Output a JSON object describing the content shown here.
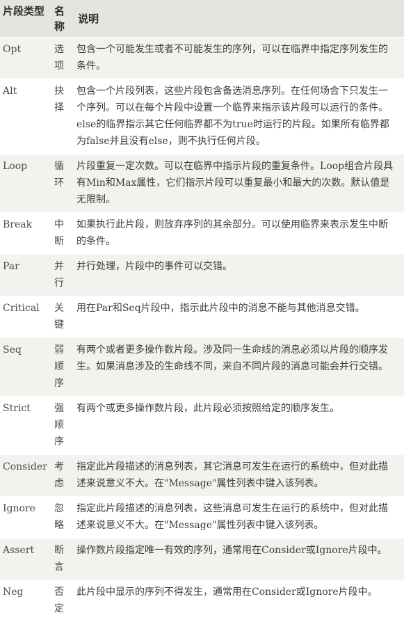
{
  "table": {
    "headers": {
      "type": "片段类型",
      "name": "名称",
      "desc": "说明"
    },
    "rows": [
      {
        "type": "Opt",
        "name": "选项",
        "desc": "包含一个可能发生或者不可能发生的序列，可以在临界中指定序列发生的条件。"
      },
      {
        "type": "Alt",
        "name": "抉择",
        "desc": "包含一个片段列表，这些片段包含备选消息序列。在任何场合下只发生一个序列。可以在每个片段中设置一个临界来指示该片段可以运行的条件。else的临界指示其它任何临界都不为true时运行的片段。如果所有临界都为false并且没有else，则不执行任何片段。"
      },
      {
        "type": "Loop",
        "name": "循环",
        "desc": "片段重复一定次数。可以在临界中指示片段的重复条件。Loop组合片段具有Min和Max属性，它们指示片段可以重复最小和最大的次数。默认值是无限制。"
      },
      {
        "type": "Break",
        "name": "中断",
        "desc": "如果执行此片段，则放弃序列的其余部分。可以使用临界来表示发生中断的条件。"
      },
      {
        "type": "Par",
        "name": "并行",
        "desc": "并行处理，片段中的事件可以交错。"
      },
      {
        "type": "Critical",
        "name": "关键",
        "desc": "用在Par和Seq片段中，指示此片段中的消息不能与其他消息交错。"
      },
      {
        "type": "Seq",
        "name": "弱顺序",
        "desc": "有两个或者更多操作数片段。涉及同一生命线的消息必须以片段的顺序发生。如果消息涉及的生命线不同，来自不同片段的消息可能会并行交错。"
      },
      {
        "type": "Strict",
        "name": "强顺序",
        "desc": "有两个或更多操作数片段，此片段必须按照给定的顺序发生。"
      },
      {
        "type": "Consider",
        "name": "考虑",
        "desc": "指定此片段描述的消息列表，其它消息可发生在运行的系统中，但对此描述来说意义不大。在\"Message\"属性列表中键入该列表。"
      },
      {
        "type": "Ignore",
        "name": "忽略",
        "desc": "指定此片段描述的消息列表，这些消息可发生在运行的系统中，但对此描述来说意义不大。在\"Message\"属性列表中键入该列表。"
      },
      {
        "type": "Assert",
        "name": "断言",
        "desc": "操作数片段指定唯一有效的序列，通常用在Consider或Ignore片段中。"
      },
      {
        "type": "Neg",
        "name": "否定",
        "desc": "此片段中显示的序列不得发生，通常用在Consider或Ignore片段中。"
      }
    ]
  }
}
